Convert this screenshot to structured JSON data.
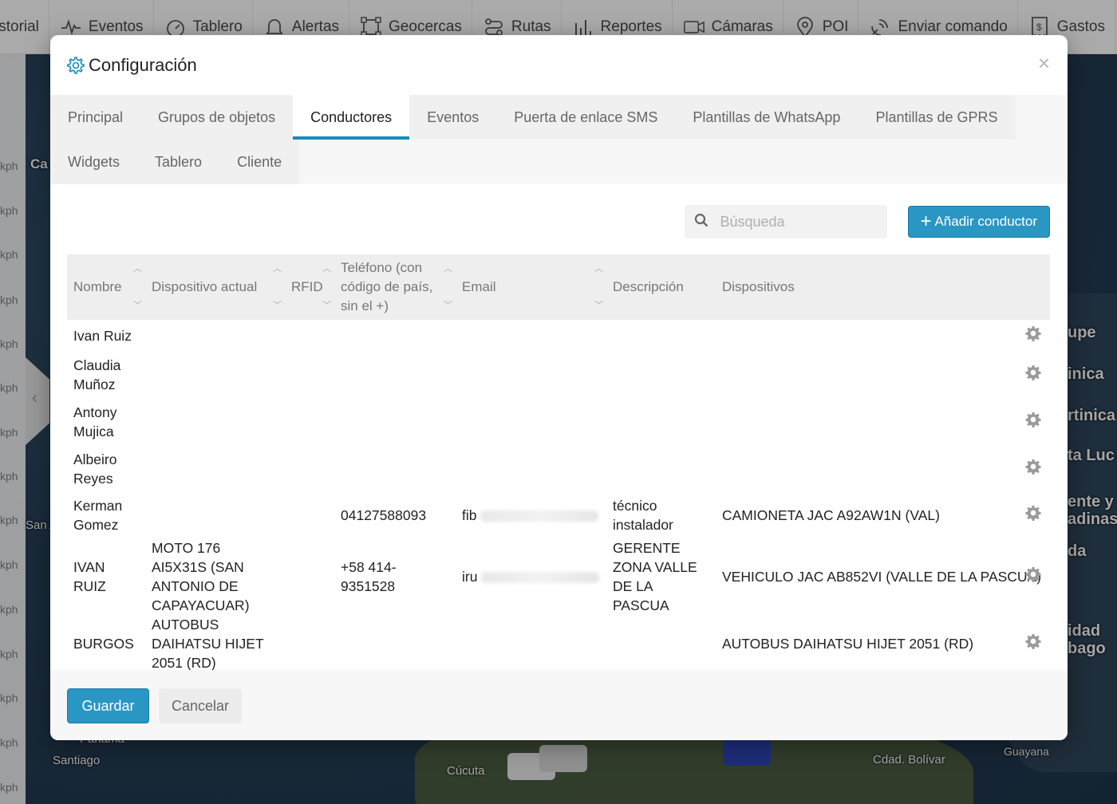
{
  "topnav": {
    "items": [
      {
        "label": "istorial",
        "icon": "history-icon"
      },
      {
        "label": "Eventos",
        "icon": "pulse-icon"
      },
      {
        "label": "Tablero",
        "icon": "gauge-icon"
      },
      {
        "label": "Alertas",
        "icon": "bell-icon"
      },
      {
        "label": "Geocercas",
        "icon": "geofence-icon"
      },
      {
        "label": "Rutas",
        "icon": "route-icon"
      },
      {
        "label": "Reportes",
        "icon": "bar-chart-icon"
      },
      {
        "label": "Cámaras",
        "icon": "camera-icon"
      },
      {
        "label": "POI",
        "icon": "map-pin-icon"
      },
      {
        "label": "Enviar comando",
        "icon": "satellite-icon"
      },
      {
        "label": "Gastos",
        "icon": "receipt-icon"
      }
    ]
  },
  "map": {
    "speed_unit": "kph",
    "labels": [
      "Ca",
      "upe",
      "inica",
      "rtinica",
      "ta Luc",
      "ente y",
      "adinas",
      "da",
      "idad",
      "bago",
      "San A",
      "Santiago",
      "Cúcuta",
      "Cdad. Bolívar",
      "Guayana",
      "Panamá"
    ]
  },
  "modal": {
    "title": "Configuración",
    "close_label": "×",
    "tabs_row1": [
      "Principal",
      "Grupos de objetos",
      "Conductores",
      "Eventos",
      "Puerta de enlace SMS",
      "Plantillas de WhatsApp",
      "Plantillas de GPRS"
    ],
    "tabs_row2": [
      "Widgets",
      "Tablero",
      "Cliente"
    ],
    "active_tab": "Conductores",
    "search": {
      "placeholder": "Búsqueda",
      "value": ""
    },
    "add_button": "Añadir conductor",
    "columns": [
      "Nombre",
      "Dispositivo actual",
      "RFID",
      "Teléfono (con código de país, sin el +)",
      "Email",
      "Descripción",
      "Dispositivos"
    ],
    "rows": [
      {
        "nombre": "Ivan Ruiz",
        "dispositivo_actual": "",
        "rfid": "",
        "telefono": "",
        "email": "",
        "descripcion": "",
        "dispositivos": ""
      },
      {
        "nombre": "Claudia Muñoz",
        "dispositivo_actual": "",
        "rfid": "",
        "telefono": "",
        "email": "",
        "descripcion": "",
        "dispositivos": ""
      },
      {
        "nombre": "Antony Mujica",
        "dispositivo_actual": "",
        "rfid": "",
        "telefono": "",
        "email": "",
        "descripcion": "",
        "dispositivos": ""
      },
      {
        "nombre": "Albeiro Reyes",
        "dispositivo_actual": "",
        "rfid": "",
        "telefono": "",
        "email": "",
        "descripcion": "",
        "dispositivos": ""
      },
      {
        "nombre": "Kerman Gomez",
        "dispositivo_actual": "",
        "rfid": "",
        "telefono": "04127588093",
        "email": "fib",
        "descripcion": "técnico instalador",
        "dispositivos": "CAMIONETA JAC A92AW1N (VAL)"
      },
      {
        "nombre": "IVAN RUIZ",
        "dispositivo_actual": "MOTO 176 AI5X31S (SAN ANTONIO DE CAPAYACUAR)",
        "rfid": "",
        "telefono": "+58 414-9351528",
        "email": "iru",
        "descripcion": "GERENTE ZONA VALLE DE LA PASCUA",
        "dispositivos": "VEHICULO JAC AB852VI (VALLE DE LA PASCUA)"
      },
      {
        "nombre": "BURGOS",
        "dispositivo_actual": "AUTOBUS DAIHATSU HIJET 2051 (RD)",
        "rfid": "",
        "telefono": "",
        "email": "",
        "descripcion": "",
        "dispositivos": "AUTOBUS DAIHATSU HIJET 2051 (RD)"
      }
    ],
    "footer": {
      "save": "Guardar",
      "cancel": "Cancelar"
    },
    "colors": {
      "accent": "#2a96c4",
      "gear": "#1a8cb8"
    }
  }
}
